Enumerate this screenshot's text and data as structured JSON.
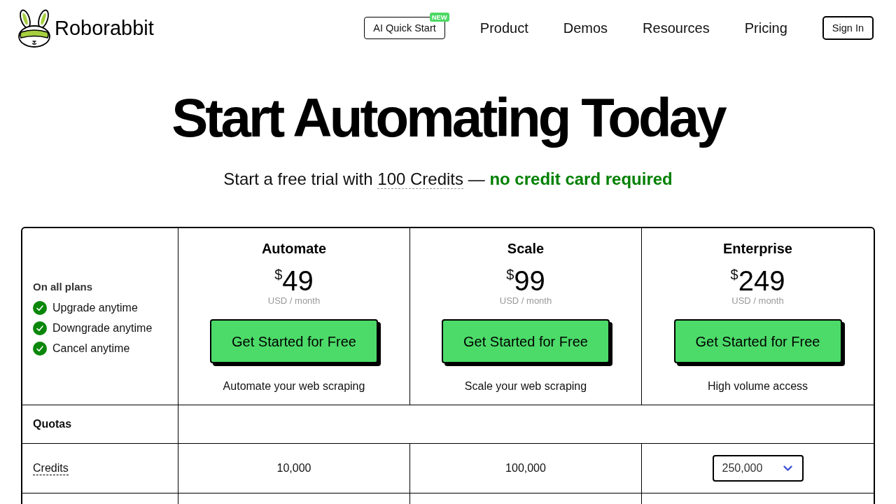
{
  "header": {
    "brand": "Roborabbit",
    "nav": [
      {
        "kind": "button",
        "label": "AI Quick Start",
        "badge": "NEW"
      },
      {
        "kind": "link",
        "label": "Product"
      },
      {
        "kind": "link",
        "label": "Demos"
      },
      {
        "kind": "link",
        "label": "Resources"
      },
      {
        "kind": "link",
        "label": "Pricing"
      },
      {
        "kind": "outline",
        "label": "Sign In"
      }
    ]
  },
  "hero": {
    "title": "Start Automating Today",
    "subtitle": {
      "lead": "Start a free trial with",
      "term": "100 Credits",
      "tail": "— **no credit card required**"
    }
  },
  "pricing": {
    "all_plans": {
      "title": "On all plans",
      "items": [
        "Upgrade anytime",
        "Downgrade anytime",
        "Cancel anytime"
      ]
    },
    "plans": [
      {
        "name": "Automate",
        "currency": "$",
        "price": "49",
        "period": "USD / month",
        "cta": "Get Started for Free",
        "tagline": "Automate your web scraping"
      },
      {
        "name": "Scale",
        "currency": "$",
        "price": "99",
        "period": "USD / month",
        "cta": "Get Started for Free",
        "tagline": "Scale your web scraping"
      },
      {
        "name": "Enterprise",
        "currency": "$",
        "price": "249",
        "period": "USD / month",
        "cta": "Get Started for Free",
        "tagline": "High volume access"
      }
    ],
    "sections": [
      {
        "title": "Quotas",
        "rows": [
          {
            "label": "Credits",
            "values": [
              {
                "kind": "text",
                "text": "10,000"
              },
              {
                "kind": "text",
                "text": "100,000"
              },
              {
                "kind": "select",
                "value": "250,000"
              }
            ]
          }
        ]
      }
    ]
  }
}
